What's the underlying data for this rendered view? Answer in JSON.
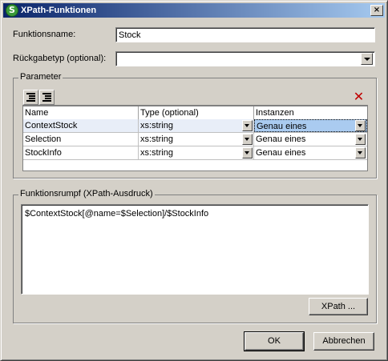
{
  "window": {
    "title": "XPath-Funktionen",
    "close_glyph": "×",
    "icon": "app-icon"
  },
  "form": {
    "function_name_label": "Funktionsname:",
    "function_name_value": "Stock",
    "return_type_label": "Rückgabetyp (optional):",
    "return_type_value": ""
  },
  "parameters": {
    "group_title": "Parameter",
    "toolbar": {
      "append_icon": "append-row-icon",
      "insert_icon": "insert-row-icon",
      "delete_icon": "delete-icon",
      "delete_glyph": "✕"
    },
    "columns": [
      "Name",
      "Type (optional)",
      "Instanzen"
    ],
    "rows": [
      {
        "name": "ContextStock",
        "type": "xs:string",
        "instances": "Genau eines"
      },
      {
        "name": "Selection",
        "type": "xs:string",
        "instances": "Genau eines"
      },
      {
        "name": "StockInfo",
        "type": "xs:string",
        "instances": "Genau eines"
      }
    ]
  },
  "body": {
    "group_title": "Funktionsrumpf (XPath-Ausdruck)",
    "expression": "$ContextStock[@name=$Selection]/$StockInfo",
    "xpath_button": "XPath ..."
  },
  "buttons": {
    "ok": "OK",
    "cancel": "Abbrechen"
  },
  "colors": {
    "titlebar_start": "#0a246a",
    "titlebar_end": "#a6caf0",
    "dialog_bg": "#d4d0c8",
    "selection": "#aacbf0",
    "delete_red": "#c00000"
  }
}
